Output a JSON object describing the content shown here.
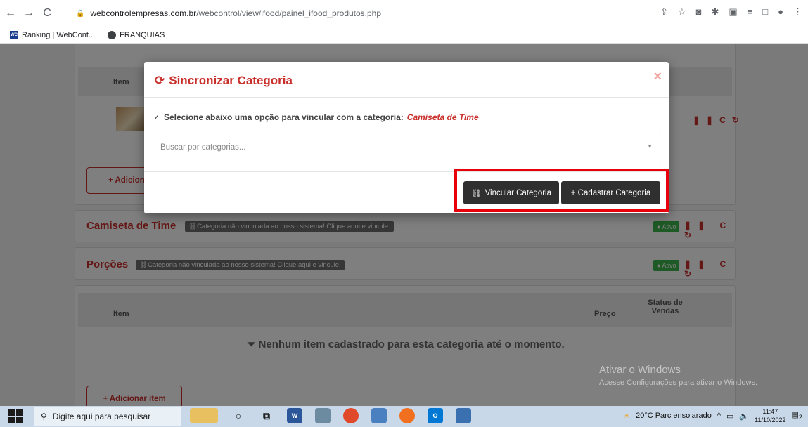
{
  "browser": {
    "url_host": "webcontrolempresas.com.br",
    "url_path": "/webcontrol/view/ifood/painel_ifood_produtos.php",
    "bookmarks": [
      {
        "label": "Ranking | WebCont...",
        "favicon": "WC"
      },
      {
        "label": "FRANQUIAS"
      }
    ]
  },
  "page": {
    "table_header_item": "Item",
    "table_header_preco": "Preço",
    "table_header_status": "Status de Vendas",
    "add_item_label": "+ Adicionar item",
    "add_item_partial_label": "+ Adiciona",
    "categories": [
      {
        "name": "Camiseta de Time",
        "warning": "Categoria não vinculada ao nosso sistema! Clique aqui e vincule.",
        "status": "Ativo"
      },
      {
        "name": "Porções",
        "warning": "Categoria não vinculada ao nosso sistema! Clique aqui e vincule.",
        "status": "Ativo"
      }
    ],
    "empty_message": "Nenhum item cadastrado para esta categoria até o momento."
  },
  "modal": {
    "title": "Sincronizar Categoria",
    "instruction": "Selecione abaixo uma opção para vincular com a categoria:",
    "category": "Camiseta de Time",
    "search_placeholder": "Buscar por categorias...",
    "link_button": "Vincular Categoria",
    "create_button": "+ Cadastrar Categoria"
  },
  "watermark": {
    "title": "Ativar o Windows",
    "subtitle": "Acesse Configurações para ativar o Windows."
  },
  "taskbar": {
    "search_placeholder": "Digite aqui para pesquisar",
    "weather": "20°C  Parc ensolarado",
    "time": "11:47",
    "date": "11/10/2022",
    "notifications": "2"
  },
  "colors": {
    "accent": "#c9302c",
    "active": "#3cb44b",
    "highlight": "#e8000b"
  }
}
